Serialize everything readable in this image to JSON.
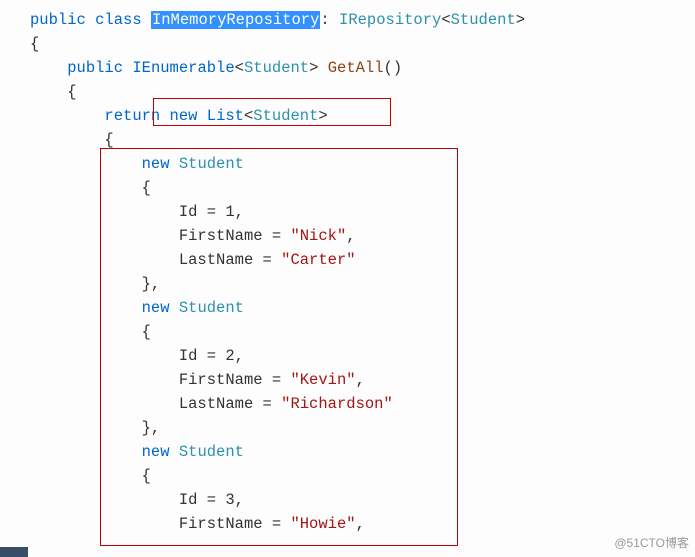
{
  "code": {
    "kw_public": "public",
    "kw_class": "class",
    "class_name": "InMemoryRepository",
    "iface": "IRepository",
    "type_student": "Student",
    "kw_ienum": "IEnumerable",
    "method": "GetAll",
    "kw_return": "return",
    "kw_new": "new",
    "kw_list": "List",
    "prop_id": "Id",
    "prop_first": "FirstName",
    "prop_last": "LastName",
    "s1_id": "1",
    "s1_first": "\"Nick\"",
    "s1_last": "\"Carter\"",
    "s2_id": "2",
    "s2_first": "\"Kevin\"",
    "s2_last": "\"Richardson\"",
    "s3_id": "3",
    "s3_first": "\"Howie\""
  },
  "watermark": "@51CTO博客"
}
